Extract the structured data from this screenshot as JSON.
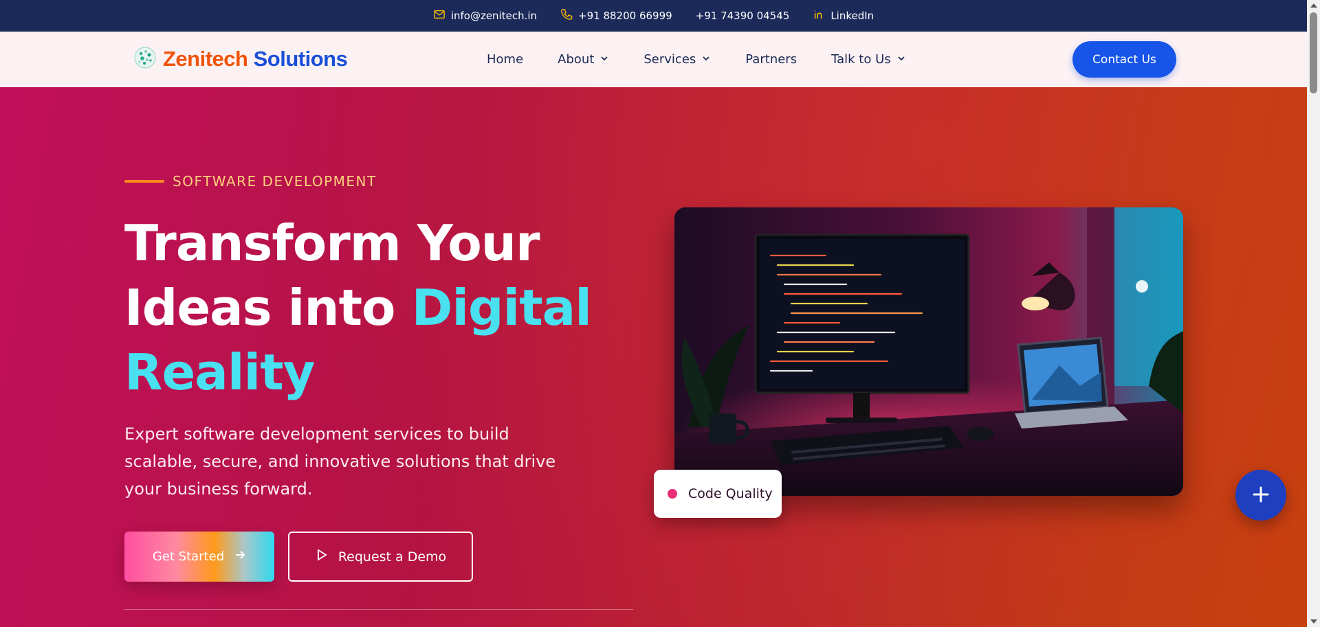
{
  "topbar": {
    "email": "info@zenitech.in",
    "phone1": "+91 88200 66999",
    "phone2": "+91 74390 04545",
    "linkedin": "LinkedIn"
  },
  "nav": {
    "brand_part1": "Zenitech",
    "brand_part2": "Solutions",
    "items": [
      {
        "label": "Home",
        "dropdown": false
      },
      {
        "label": "About",
        "dropdown": true
      },
      {
        "label": "Services",
        "dropdown": true
      },
      {
        "label": "Partners",
        "dropdown": false
      },
      {
        "label": "Talk to Us",
        "dropdown": true
      }
    ],
    "contact_label": "Contact Us"
  },
  "hero": {
    "eyebrow": "SOFTWARE DEVELOPMENT",
    "headline_line1": "Transform Your",
    "headline_line2_a": "Ideas into ",
    "headline_line2_b": "Digital",
    "headline_line3": "Reality",
    "subtext": "Expert software development services to build scalable, secure, and innovative solutions that drive your business forward.",
    "get_started_label": "Get Started",
    "demo_label": "Request a Demo",
    "badge_label": "Code Quality"
  },
  "colors": {
    "topbar": "#1c2a5a",
    "brand_orange": "#f0540a",
    "brand_blue": "#1a4fd8",
    "accent_cyan": "#49e0f0",
    "eyebrow": "#ffd27a",
    "cta_blue": "#1754e8"
  },
  "icons": [
    "mail-icon",
    "phone-icon",
    "linkedin-icon",
    "chevron-down-icon",
    "arrow-right-icon",
    "play-icon",
    "plus-icon"
  ]
}
